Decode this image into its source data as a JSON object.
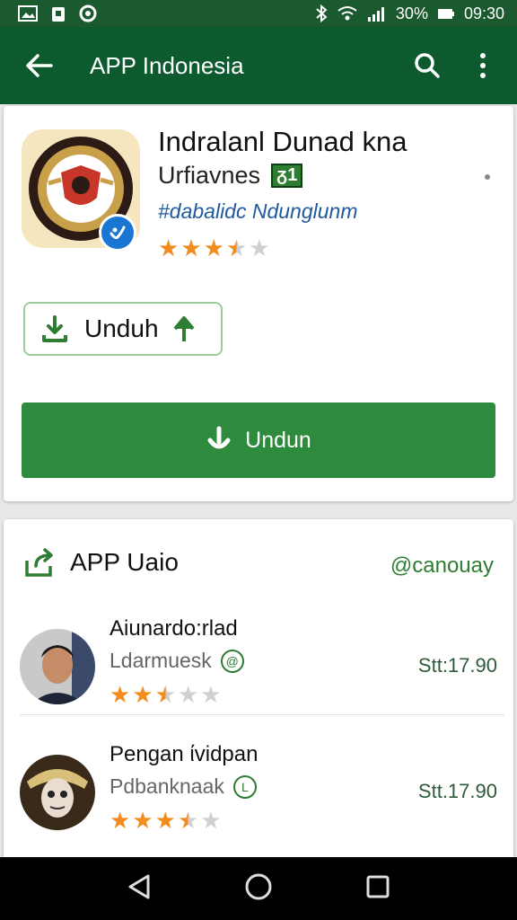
{
  "status": {
    "battery": "30%",
    "time": "09:30",
    "left_icons": [
      "image-icon",
      "android-icon",
      "circle-app-icon"
    ],
    "right_icons": [
      "bluetooth-icon",
      "wifi-icon",
      "signal-icon",
      "battery-icon"
    ]
  },
  "app_bar": {
    "title": "APP Indonesia",
    "back_icon": "arrow-left-icon",
    "search_icon": "search-icon",
    "menu_icon": "more-vert-icon"
  },
  "app": {
    "name": "Indralanl Dunad kna",
    "developer": "Urfiavnes",
    "developer_badge": "ᵹ1",
    "meta": "#dabalidc Ndunglunm",
    "rating": 3.5,
    "small_download_label": "Unduh",
    "download_label": "Undun"
  },
  "reviews_section": {
    "title": "APP Uaio",
    "link": "@canouay",
    "reviews": [
      {
        "name": "Aiunardo:rlad",
        "subtitle": "Ldarmuesk",
        "badge": "@",
        "time": "Stt:17.90",
        "rating": 2.5
      },
      {
        "name": "Pengan ίvidpan",
        "subtitle": "Pdbanknaak",
        "badge": "L",
        "time": "Stt.17.90",
        "rating": 3.5
      }
    ]
  },
  "colors": {
    "primary": "#0e5a2f",
    "accent": "#2e8b3e",
    "star": "#f28c1e",
    "verified": "#1976d2"
  }
}
